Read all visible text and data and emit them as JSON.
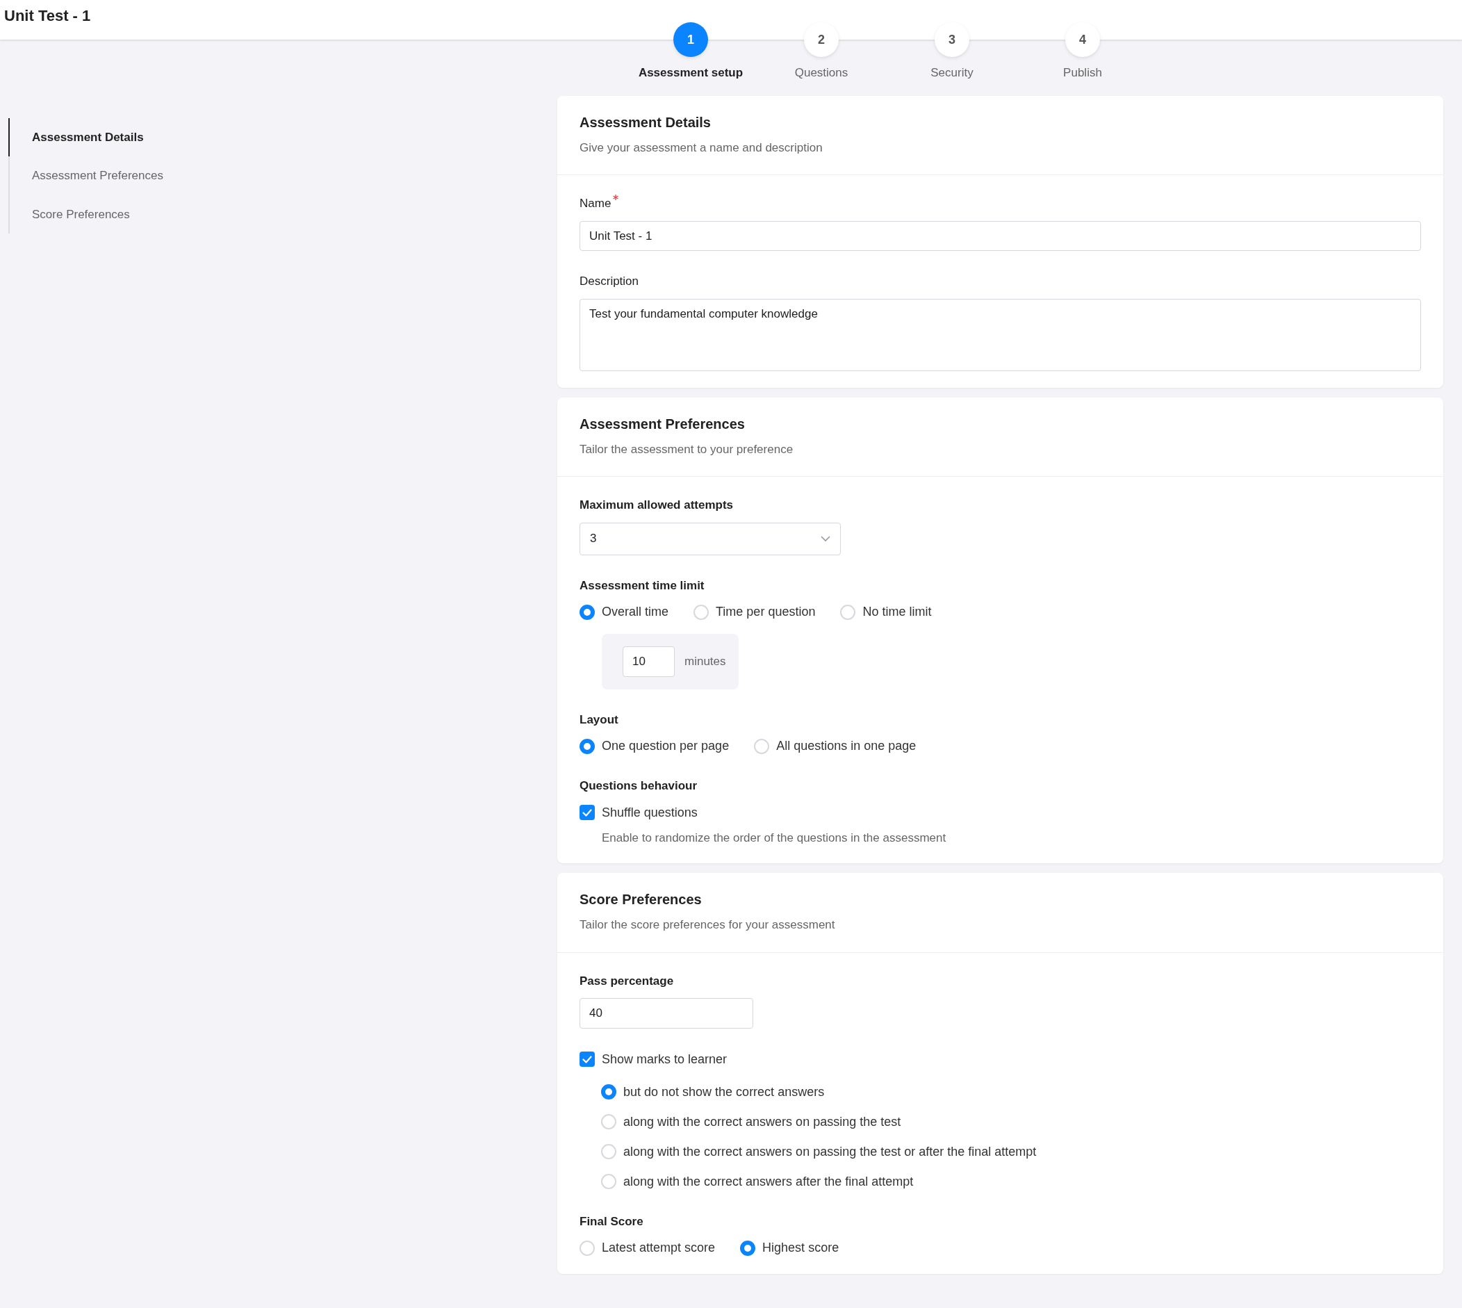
{
  "page": {
    "title": "Unit Test - 1"
  },
  "stepper": [
    {
      "number": "1",
      "label": "Assessment setup",
      "selected": true
    },
    {
      "number": "2",
      "label": "Questions",
      "selected": false
    },
    {
      "number": "3",
      "label": "Security",
      "selected": false
    },
    {
      "number": "4",
      "label": "Publish",
      "selected": false
    }
  ],
  "sidebar": {
    "items": [
      {
        "label": "Assessment Details",
        "selected": true
      },
      {
        "label": "Assessment Preferences",
        "selected": false
      },
      {
        "label": "Score Preferences",
        "selected": false
      }
    ]
  },
  "sections": [
    {
      "title": "Assessment Details",
      "subtitle": "Give your assessment a name and description",
      "fields": [
        {
          "kind": "text",
          "label": "Name",
          "required": true,
          "value": "Unit Test - 1"
        },
        {
          "kind": "textarea",
          "label": "Description",
          "value": "Test your fundamental computer knowledge"
        }
      ]
    },
    {
      "title": "Assessment Preferences",
      "subtitle": "Tailor the assessment to your preference",
      "fields": [
        {
          "kind": "select",
          "label": "Maximum allowed attempts",
          "value": "3"
        },
        {
          "kind": "radios",
          "label": "Assessment time limit",
          "options": [
            {
              "label": "Overall time",
              "selected": true
            },
            {
              "label": "Time per question",
              "selected": false
            },
            {
              "label": "No time limit",
              "selected": false
            }
          ],
          "duration": {
            "value": "10",
            "unit": "minutes"
          }
        },
        {
          "kind": "radios",
          "label": "Layout",
          "options": [
            {
              "label": "One question per page",
              "selected": true
            },
            {
              "label": "All questions in one page",
              "selected": false
            }
          ]
        },
        {
          "kind": "checkbox",
          "label": "Questions behaviour",
          "checkbox": {
            "label": "Shuffle questions",
            "checked": true,
            "help": "Enable to randomize the order of the questions in the assessment"
          }
        }
      ]
    },
    {
      "title": "Score Preferences",
      "subtitle": "Tailor the score preferences for your assessment",
      "fields": [
        {
          "kind": "short_text",
          "label": "Pass percentage",
          "value": "40"
        },
        {
          "kind": "checkbox",
          "checkbox": {
            "label": "Show marks to learner",
            "checked": true,
            "options": [
              {
                "label": "but do not show the correct answers",
                "selected": true
              },
              {
                "label": "along with the correct answers on passing the test",
                "selected": false
              },
              {
                "label": "along with the correct answers on passing the test or after the final attempt",
                "selected": false
              },
              {
                "label": "along with the correct answers after the final attempt",
                "selected": false
              }
            ]
          }
        },
        {
          "kind": "radios",
          "label": "Final Score",
          "options": [
            {
              "label": "Latest attempt score",
              "selected": false
            },
            {
              "label": "Highest score",
              "selected": true
            }
          ]
        }
      ]
    }
  ]
}
